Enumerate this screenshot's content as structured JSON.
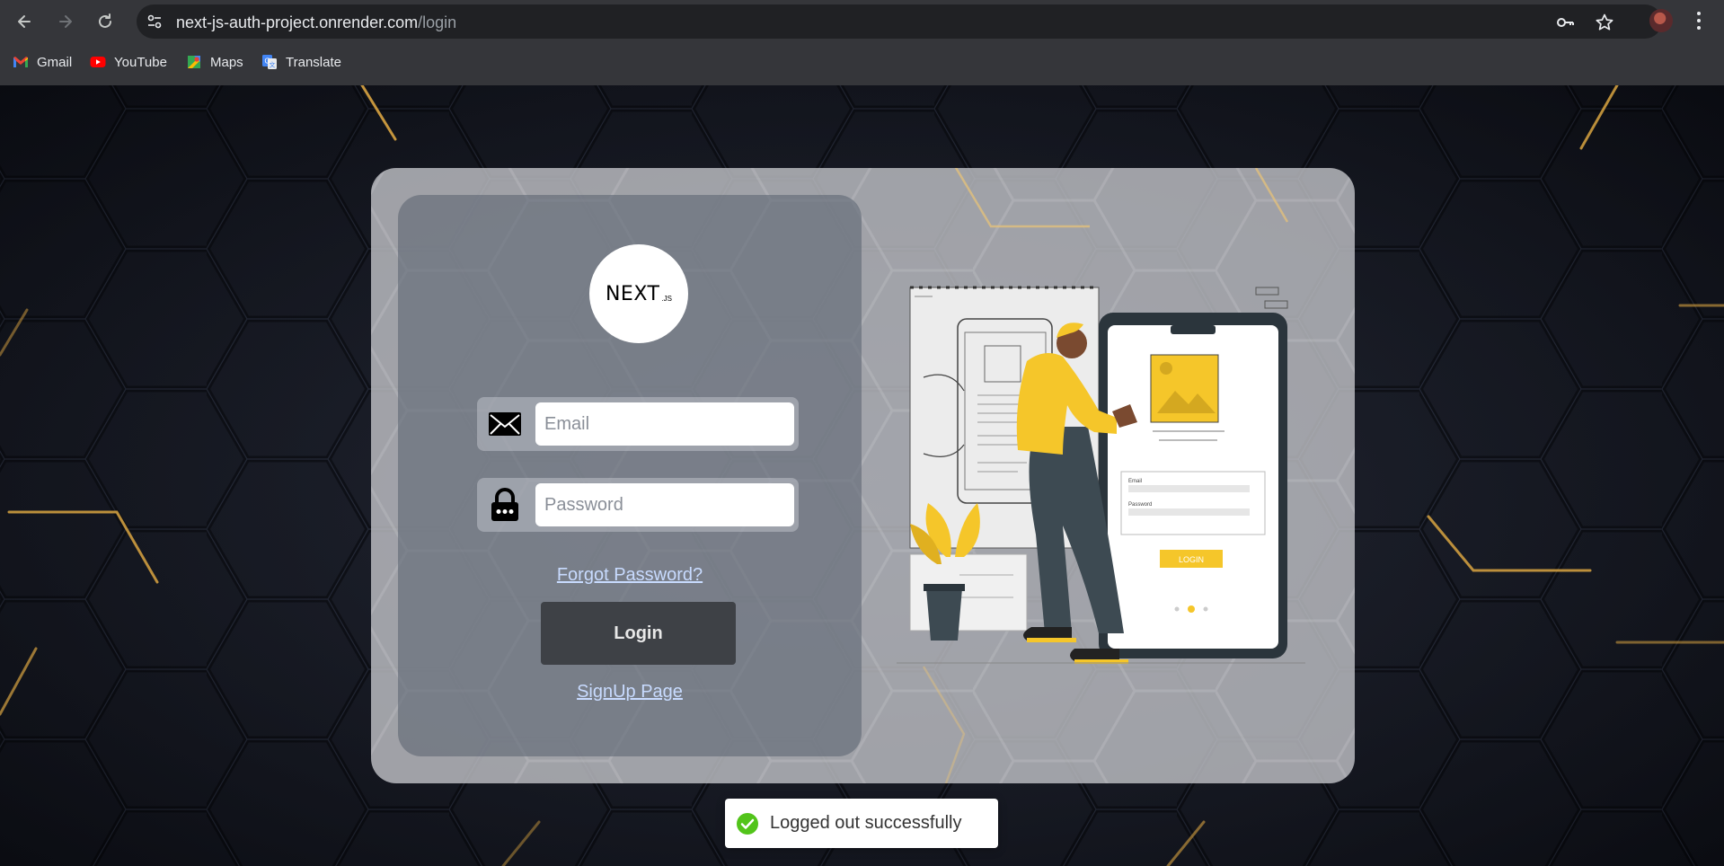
{
  "browser": {
    "url_host": "next-js-auth-project.onrender.com",
    "url_path": "/login",
    "bookmarks": [
      {
        "label": "Gmail",
        "icon": "gmail-icon"
      },
      {
        "label": "YouTube",
        "icon": "youtube-icon"
      },
      {
        "label": "Maps",
        "icon": "maps-icon"
      },
      {
        "label": "Translate",
        "icon": "translate-icon"
      }
    ]
  },
  "login_form": {
    "logo_text": "NEXT",
    "logo_suffix": ".JS",
    "email_placeholder": "Email",
    "password_placeholder": "Password",
    "forgot_label": "Forgot Password?",
    "login_label": "Login",
    "signup_label": "SignUp Page"
  },
  "illustration": {
    "phone_email_label": "Email",
    "phone_password_label": "Password",
    "phone_button_label": "LOGIN"
  },
  "toast": {
    "message": "Logged out successfully",
    "status": "success",
    "color": "#52c41a"
  },
  "colors": {
    "accent_yellow": "#f5c62a",
    "hex_gold": "#d9a441"
  }
}
